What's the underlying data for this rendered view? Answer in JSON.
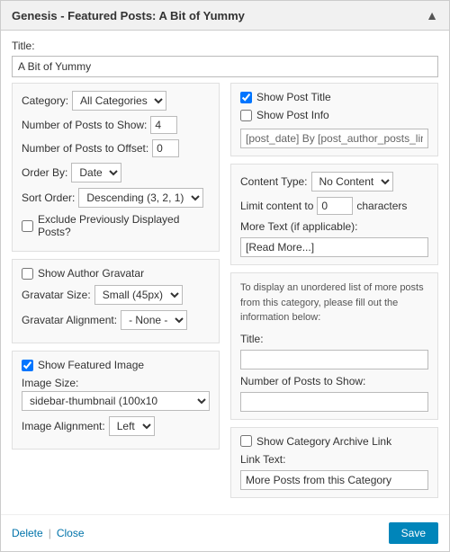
{
  "widget": {
    "header_title": "Genesis - Featured Posts: A Bit of Yummy",
    "arrow": "▲",
    "title_label": "Title:",
    "title_value": "A Bit of Yummy"
  },
  "left_col": {
    "section1": {
      "category_label": "Category:",
      "category_value": "All Categories",
      "num_posts_label": "Number of Posts to Show:",
      "num_posts_value": "4",
      "num_offset_label": "Number of Posts to Offset:",
      "num_offset_value": "0",
      "order_by_label": "Order By:",
      "order_by_value": "Date",
      "sort_order_label": "Sort Order:",
      "sort_order_value": "Descending (3, 2, 1)",
      "exclude_label": "Exclude Previously Displayed Posts?"
    },
    "section2": {
      "show_gravatar_label": "Show Author Gravatar",
      "gravatar_size_label": "Gravatar Size:",
      "gravatar_size_value": "Small (45px)",
      "gravatar_align_label": "Gravatar Alignment:",
      "gravatar_align_value": "- None -"
    },
    "section3": {
      "show_image_label": "Show Featured Image",
      "image_size_label": "Image Size:",
      "image_size_value": "sidebar-thumbnail (100x10",
      "image_align_label": "Image Alignment:",
      "image_align_value": "Left"
    }
  },
  "right_col": {
    "section1": {
      "show_title_label": "Show Post Title",
      "show_info_label": "Show Post Info",
      "post_info_value": "[post_date] By [post_author_posts_link] ["
    },
    "section2": {
      "content_type_label": "Content Type:",
      "content_type_value": "No Content",
      "limit_label": "Limit content to",
      "limit_value": "0",
      "limit_suffix": "characters",
      "more_text_label": "More Text (if applicable):",
      "more_text_value": "[Read More...]"
    },
    "section3": {
      "description": "To display an unordered list of more posts from this category, please fill out the information below:",
      "title_label": "Title:",
      "title_value": "",
      "num_posts_label": "Number of Posts to Show:",
      "num_posts_value": ""
    },
    "section4": {
      "show_archive_label": "Show Category Archive Link",
      "link_text_label": "Link Text:",
      "link_text_value": "More Posts from this Category"
    }
  },
  "footer": {
    "delete_label": "Delete",
    "close_label": "Close",
    "save_label": "Save"
  }
}
